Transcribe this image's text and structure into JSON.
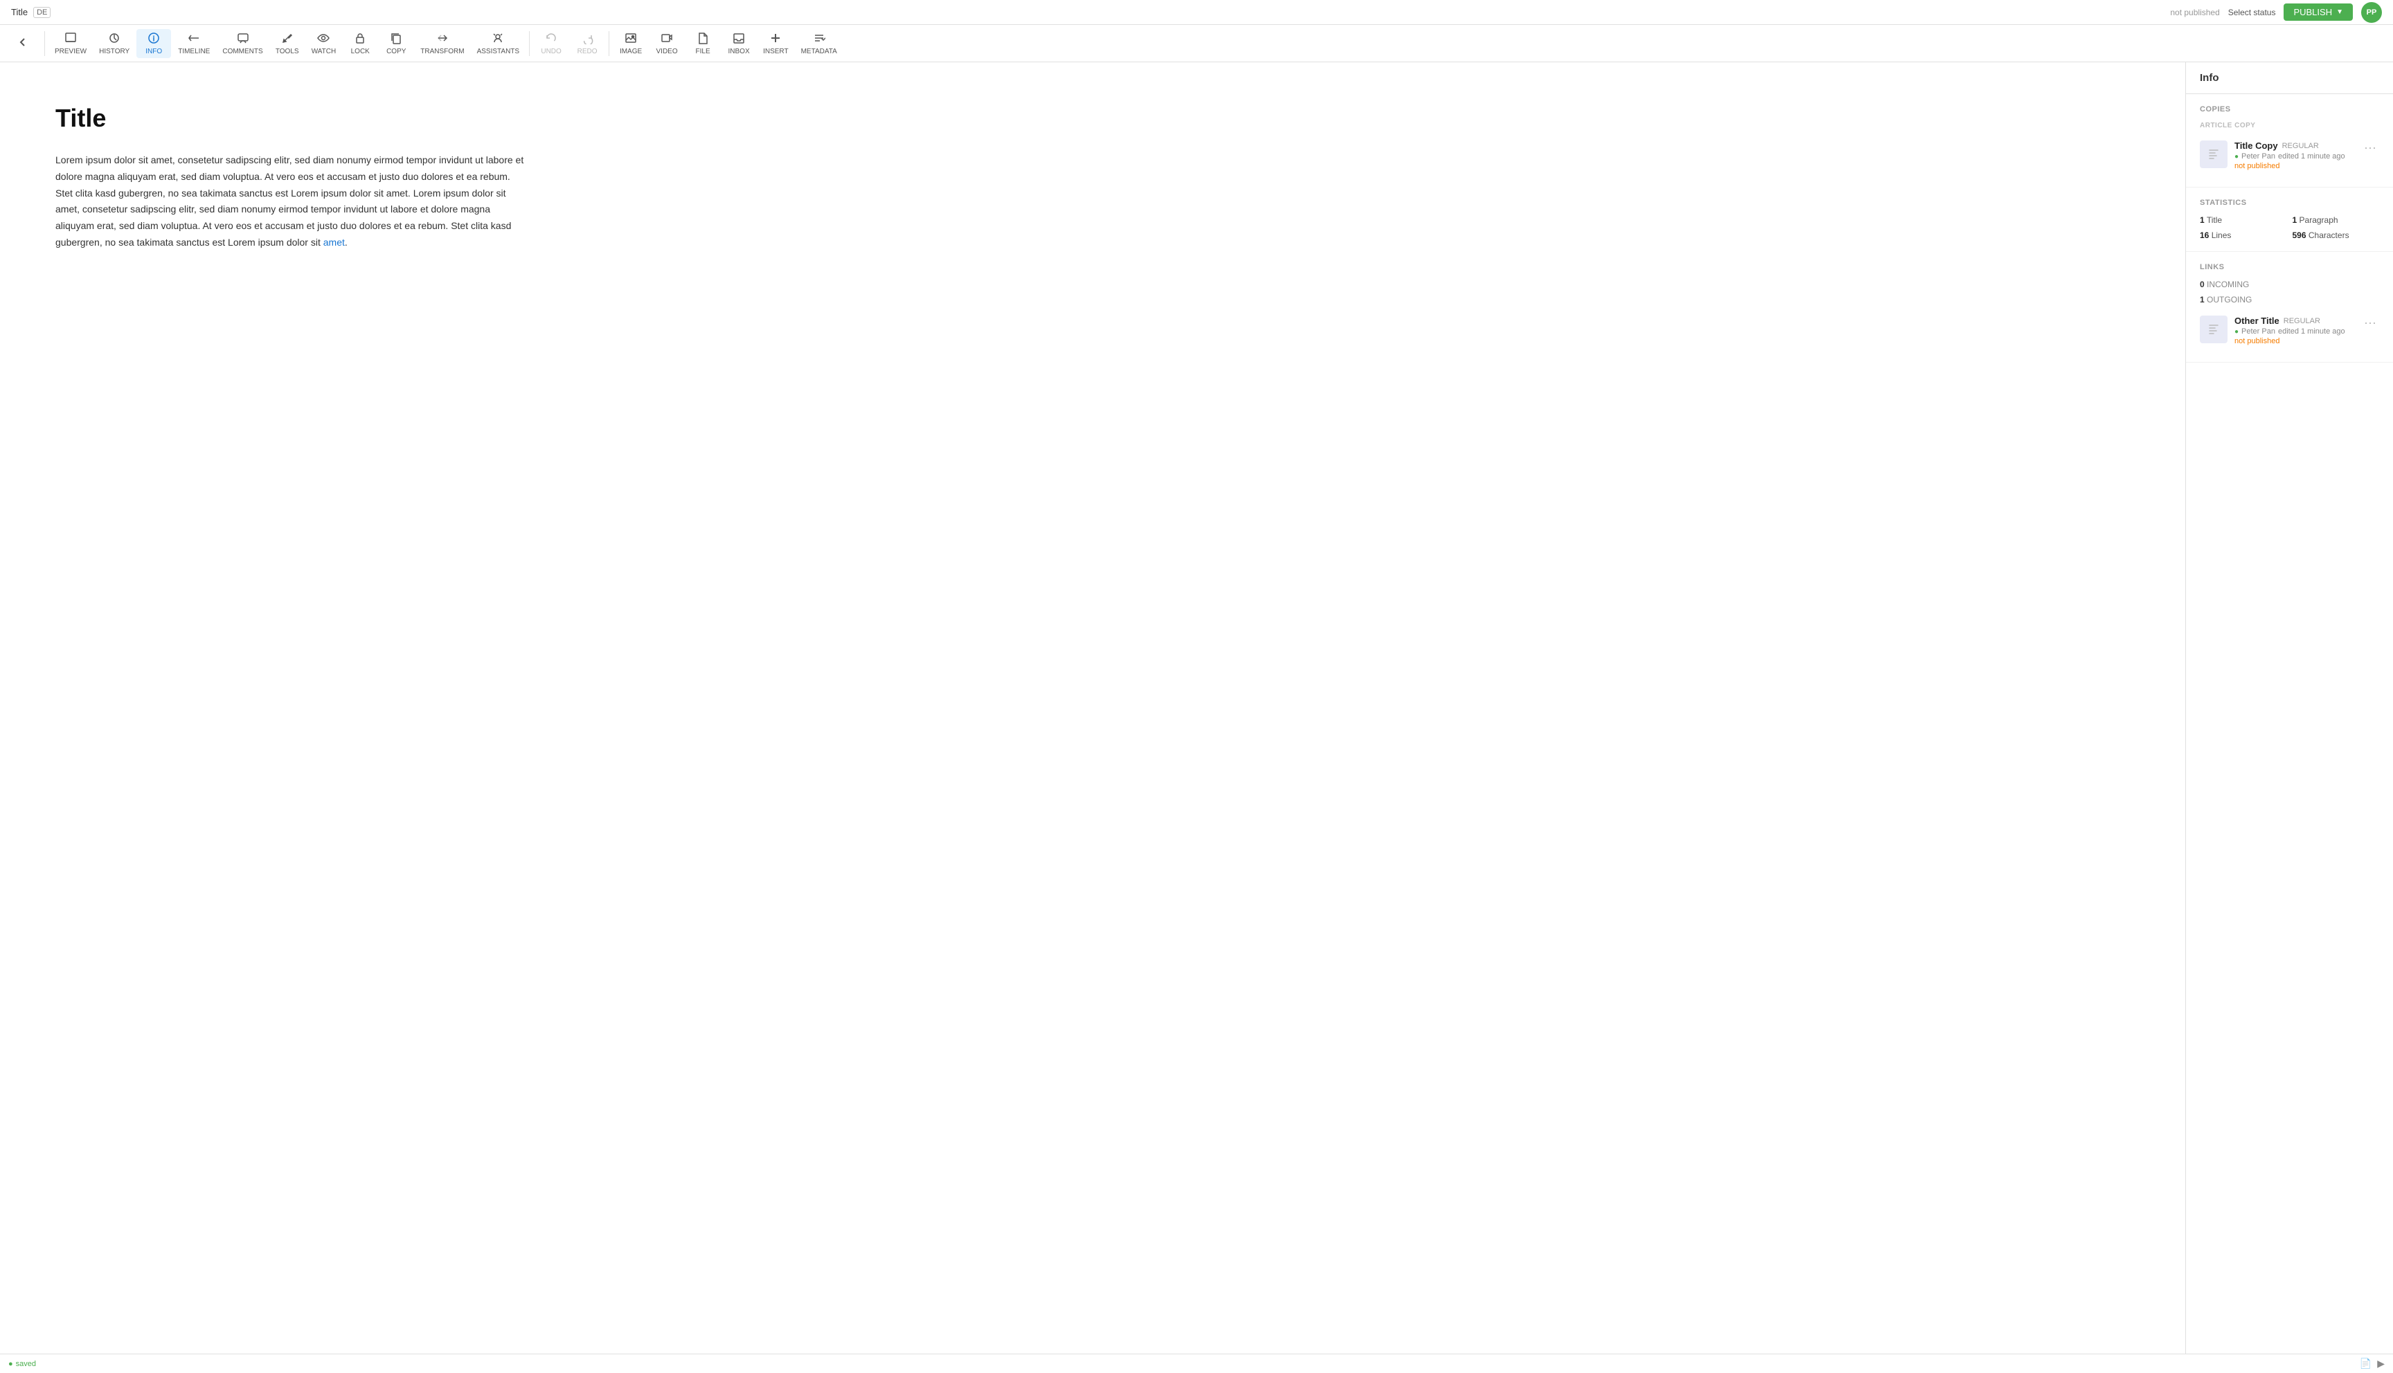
{
  "topbar": {
    "title": "Title",
    "lang": "DE",
    "not_published": "not published",
    "select_status": "Select status",
    "publish_label": "PUBLISH",
    "avatar": "PP"
  },
  "toolbar": {
    "items": [
      {
        "id": "back",
        "icon": "←",
        "label": "",
        "active": false
      },
      {
        "id": "preview",
        "icon": "⊡",
        "label": "PREVIEW",
        "active": false
      },
      {
        "id": "history",
        "icon": "↺",
        "label": "HISTORY",
        "active": false
      },
      {
        "id": "info",
        "icon": "ℹ",
        "label": "INFO",
        "active": true
      },
      {
        "id": "timeline",
        "icon": "⏱",
        "label": "TIMELINE",
        "active": false
      },
      {
        "id": "comments",
        "icon": "💬",
        "label": "COMMENTS",
        "active": false
      },
      {
        "id": "tools",
        "icon": "✂",
        "label": "TOOLS",
        "active": false
      },
      {
        "id": "watch",
        "icon": "👁",
        "label": "WATCH",
        "active": false
      },
      {
        "id": "lock",
        "icon": "🔒",
        "label": "LOCK",
        "active": false
      },
      {
        "id": "copy",
        "icon": "⧉",
        "label": "COPY",
        "active": false
      },
      {
        "id": "transform",
        "icon": "⇄",
        "label": "TRANSFORM",
        "active": false
      },
      {
        "id": "assistants",
        "icon": "🤖",
        "label": "ASSISTANTS",
        "active": false
      },
      {
        "id": "undo",
        "icon": "↩",
        "label": "UNDO",
        "active": false,
        "disabled": true
      },
      {
        "id": "redo",
        "icon": "↪",
        "label": "REDO",
        "active": false,
        "disabled": true
      },
      {
        "id": "image",
        "icon": "🖼",
        "label": "IMAGE",
        "active": false
      },
      {
        "id": "video",
        "icon": "▶",
        "label": "VIDEO",
        "active": false
      },
      {
        "id": "file",
        "icon": "📄",
        "label": "FILE",
        "active": false
      },
      {
        "id": "inbox",
        "icon": "📥",
        "label": "INBOX",
        "active": false
      },
      {
        "id": "insert",
        "icon": "＋",
        "label": "INSERT",
        "active": false
      },
      {
        "id": "metadata",
        "icon": "🏷",
        "label": "METADATA",
        "active": false
      }
    ]
  },
  "editor": {
    "title": "Title",
    "body": "Lorem ipsum dolor sit amet, consetetur sadipscing elitr, sed diam nonumy eirmod tempor invidunt ut labore et dolore magna aliquyam erat, sed diam voluptua. At vero eos et accusam et justo duo dolores et ea rebum. Stet clita kasd gubergren, no sea takimata sanctus est Lorem ipsum dolor sit amet. Lorem ipsum dolor sit amet, consetetur sadipscing elitr, sed diam nonumy eirmod tempor invidunt ut labore et dolore magna aliquyam erat, sed diam voluptua. At vero eos et accusam et justo duo dolores et ea rebum. Stet clita kasd gubergren, no sea takimata sanctus est Lorem ipsum dolor sit ",
    "link_text": "amet",
    "body_end": "."
  },
  "sidebar": {
    "header": "Info",
    "copies_section": {
      "title": "COPIES",
      "article_copy_label": "ARTICLE COPY",
      "copy": {
        "title": "Title Copy",
        "type": "REGULAR",
        "author": "Peter Pan",
        "edited": "edited 1 minute ago",
        "status": "not published"
      }
    },
    "statistics_section": {
      "title": "STATISTICS",
      "title_count": "1",
      "title_label": "Title",
      "paragraph_count": "1",
      "paragraph_label": "Paragraph",
      "lines_count": "16",
      "lines_label": "Lines",
      "characters_count": "596",
      "characters_label": "Characters"
    },
    "links_section": {
      "title": "LINKS",
      "incoming_count": "0",
      "incoming_label": "INCOMING",
      "outgoing_count": "1",
      "outgoing_label": "OUTGOING",
      "outgoing_item": {
        "title": "Other Title",
        "type": "REGULAR",
        "author": "Peter Pan",
        "edited": "edited 1 minute ago",
        "status": "not published"
      }
    }
  },
  "bottombar": {
    "saved_text": "saved"
  }
}
